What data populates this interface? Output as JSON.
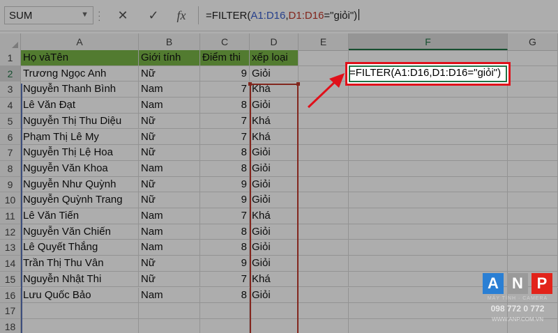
{
  "formula_bar": {
    "name_box": "SUM",
    "cancel_icon": "✕",
    "enter_icon": "✓",
    "fx_label": "fx",
    "formula_parts": {
      "p1": "=FILTER(",
      "p2": "A1:D16",
      "p3": ",",
      "p4": "D1:D16",
      "p5": "=\"giỏi\")"
    }
  },
  "columns": [
    "A",
    "B",
    "C",
    "D",
    "E",
    "F",
    "G"
  ],
  "header_row": [
    "Họ vàTên",
    "Giới tính",
    "Điểm thi",
    "xếp loại"
  ],
  "rows": [
    [
      "Trương Ngọc Anh",
      "Nữ",
      "9",
      "Giỏi"
    ],
    [
      "Nguyễn Thanh Bình",
      "Nam",
      "7",
      "Khá"
    ],
    [
      "Lê Văn Đạt",
      "Nam",
      "8",
      "Giỏi"
    ],
    [
      "Nguyễn Thị Thu Diệu",
      "Nữ",
      "7",
      "Khá"
    ],
    [
      "Phạm Thị Lê My",
      "Nữ",
      "7",
      "Khá"
    ],
    [
      "Nguyễn Thị Lệ Hoa",
      "Nữ",
      "8",
      "Giỏi"
    ],
    [
      "Nguyễn Văn Khoa",
      "Nam",
      "8",
      "Giỏi"
    ],
    [
      "Nguyễn Như Quỳnh",
      "Nữ",
      "9",
      "Giỏi"
    ],
    [
      "Nguyễn Quỳnh Trang",
      "Nữ",
      "9",
      "Giỏi"
    ],
    [
      "Lê Văn Tiến",
      "Nam",
      "7",
      "Khá"
    ],
    [
      "Nguyễn Văn Chiến",
      "Nam",
      "8",
      "Giỏi"
    ],
    [
      "Lê Quyết Thắng",
      "Nam",
      "8",
      "Giỏi"
    ],
    [
      "Trần Thị Thu Vân",
      "Nữ",
      "9",
      "Giỏi"
    ],
    [
      "Nguyễn Nhật Thi",
      "Nữ",
      "7",
      "Khá"
    ],
    [
      "Lưu Quốc Bảo",
      "Nam",
      "8",
      "Giỏi"
    ]
  ],
  "row_numbers": [
    "1",
    "2",
    "3",
    "4",
    "5",
    "6",
    "7",
    "8",
    "9",
    "10",
    "11",
    "12",
    "13",
    "14",
    "15",
    "16",
    "17",
    "18"
  ],
  "active_cell": {
    "formula_text": "=FILTER(A1:D16,D1:D16=\"giỏi\")"
  },
  "watermark": {
    "letters": [
      "A",
      "N",
      "P"
    ],
    "tagline": "MÁY TÍNH · CAMERA",
    "phone": "098 772 0 772",
    "website": "WWW.ANP.COM.VN",
    "colors": {
      "a": "#2a7fd4",
      "n": "#9a9a9a",
      "p": "#e2231a"
    }
  },
  "colors": {
    "header_fill": "#7ab648",
    "excel_green": "#217346",
    "highlight_red": "#e0101a",
    "range_blue": "#3a5fcd",
    "range_red": "#c0392b"
  }
}
